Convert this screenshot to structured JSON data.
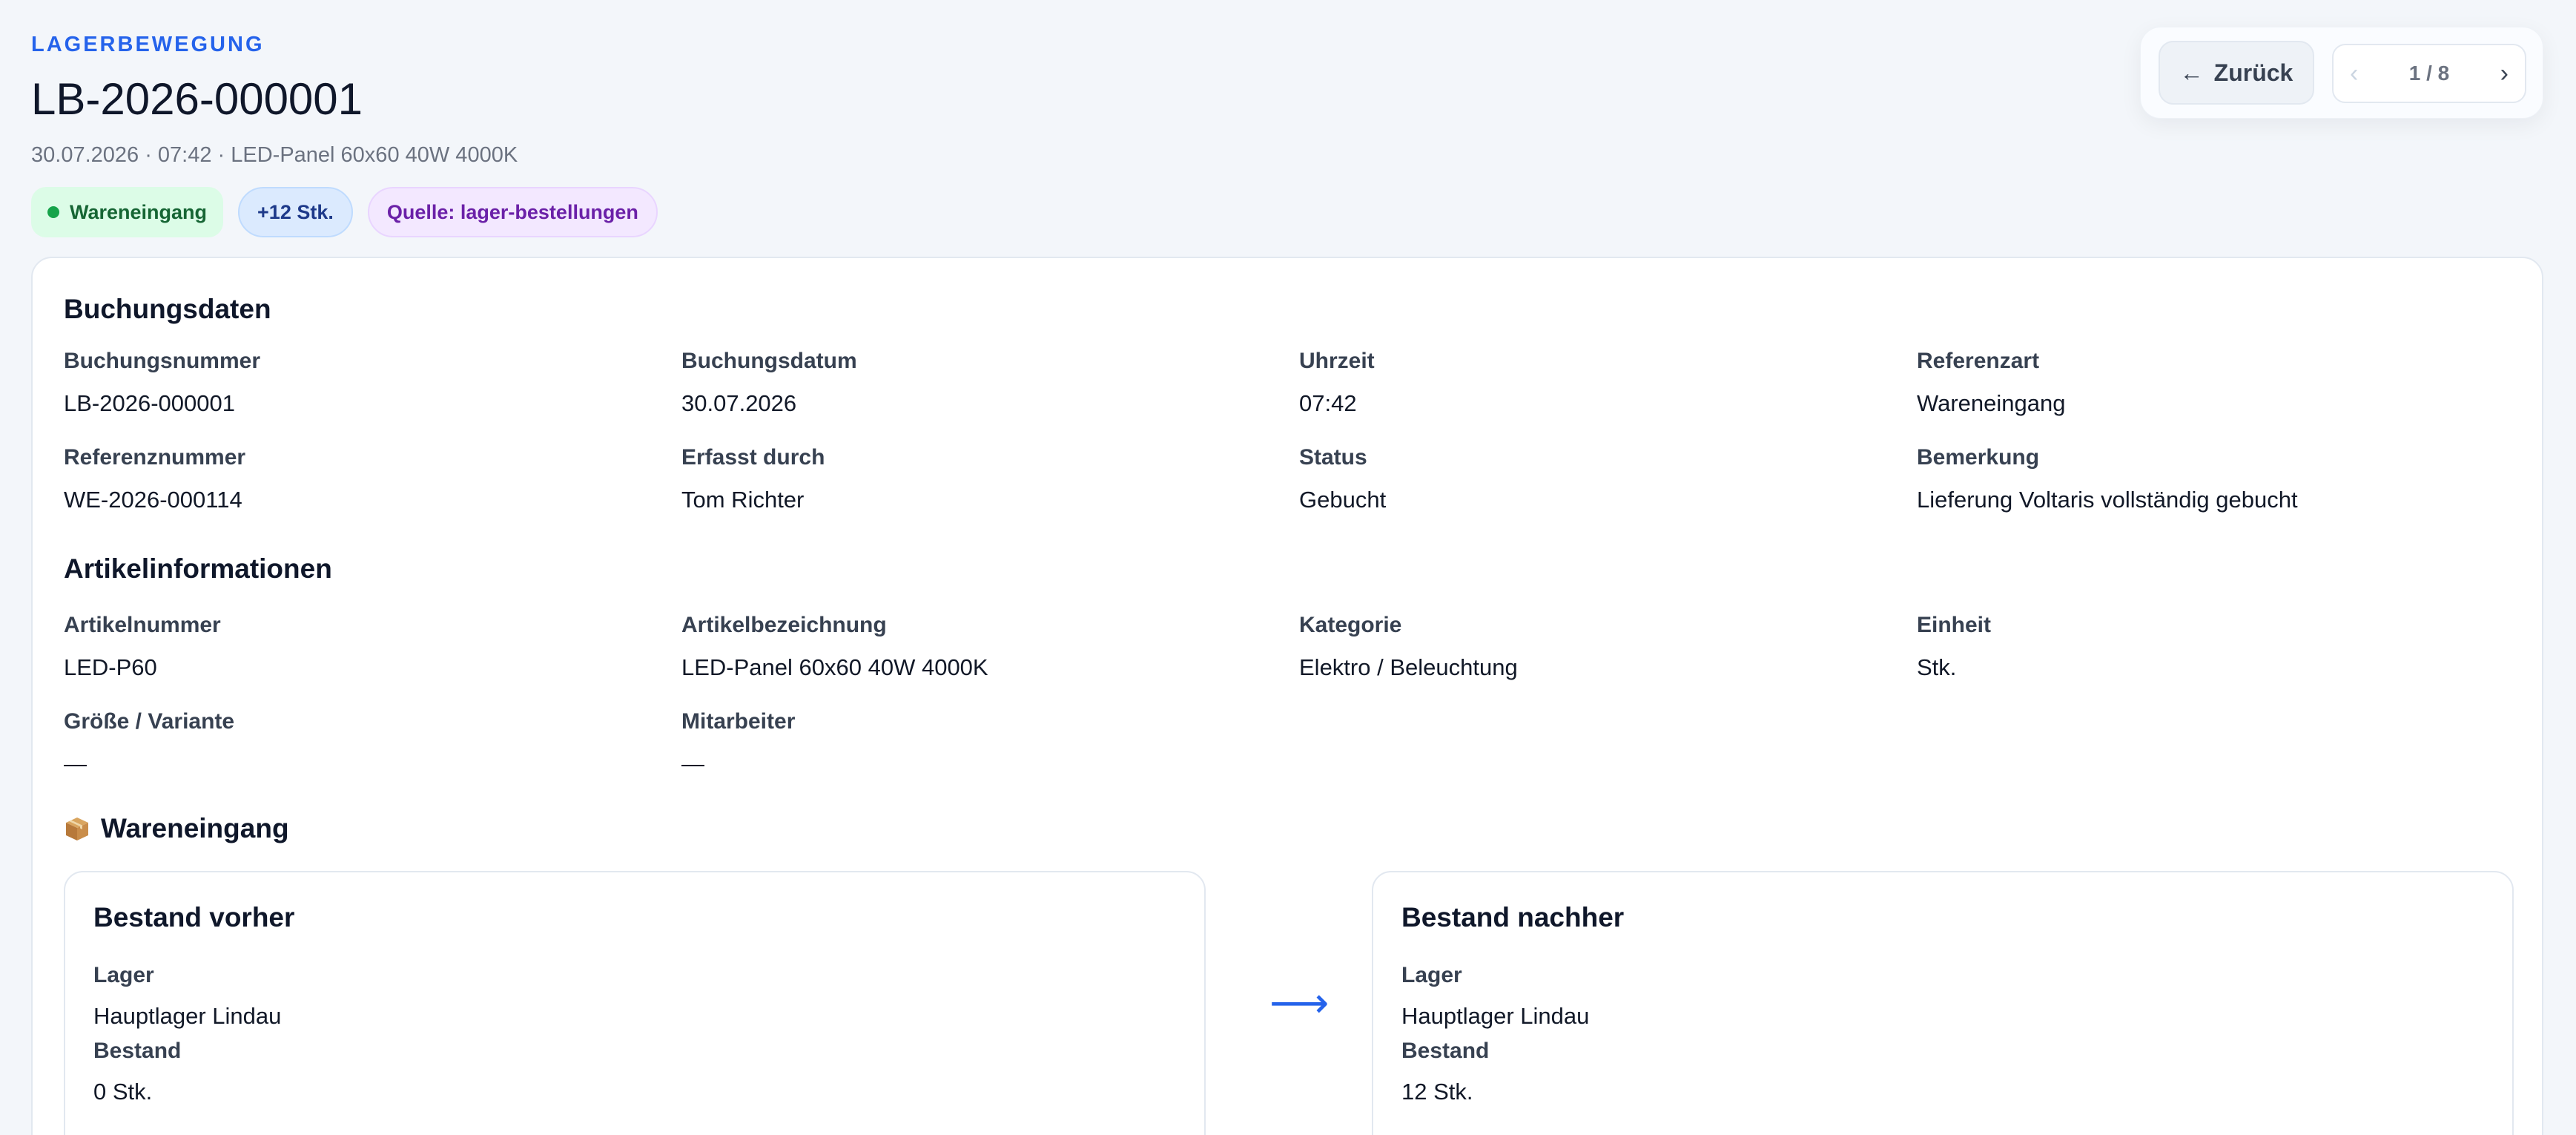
{
  "header": {
    "eyebrow": "LAGERBEWEGUNG",
    "title": "LB-2026-000001",
    "subline": "30.07.2026 · 07:42 · LED-Panel 60x60 40W 4000K",
    "badges": {
      "type": "Wareneingang",
      "quantity": "+12 Stk.",
      "source": "Quelle: lager-bestellungen"
    }
  },
  "nav": {
    "back_arrow": "←",
    "back_label": "Zurück",
    "prev": "‹",
    "page_indicator": "1 / 8",
    "next": "›"
  },
  "booking": {
    "title": "Buchungsdaten",
    "fields": [
      {
        "label": "Buchungsnummer",
        "value": "LB-2026-000001"
      },
      {
        "label": "Buchungsdatum",
        "value": "30.07.2026"
      },
      {
        "label": "Uhrzeit",
        "value": "07:42"
      },
      {
        "label": "Referenzart",
        "value": "Wareneingang"
      },
      {
        "label": "Referenznummer",
        "value": "WE-2026-000114"
      },
      {
        "label": "Erfasst durch",
        "value": "Tom Richter"
      },
      {
        "label": "Status",
        "value": "Gebucht"
      },
      {
        "label": "Bemerkung",
        "value": "Lieferung Voltaris vollständig gebucht"
      }
    ]
  },
  "article": {
    "title": "Artikelinformationen",
    "fields": [
      {
        "label": "Artikelnummer",
        "value": "LED-P60"
      },
      {
        "label": "Artikelbezeichnung",
        "value": "LED-Panel 60x60 40W 4000K"
      },
      {
        "label": "Kategorie",
        "value": "Elektro / Beleuchtung"
      },
      {
        "label": "Einheit",
        "value": "Stk."
      },
      {
        "label": "Größe / Variante",
        "value": "—"
      },
      {
        "label": "Mitarbeiter",
        "value": "—"
      }
    ]
  },
  "movement": {
    "icon": "package-icon",
    "title": "Wareneingang",
    "arrow": "⟶",
    "before": {
      "title": "Bestand vorher",
      "warehouse_label": "Lager",
      "warehouse_value": "Hauptlager Lindau",
      "stock_label": "Bestand",
      "stock_value": "0 Stk."
    },
    "after": {
      "title": "Bestand nachher",
      "warehouse_label": "Lager",
      "warehouse_value": "Hauptlager Lindau",
      "stock_label": "Bestand",
      "stock_value": "12 Stk."
    }
  },
  "colors": {
    "accent": "#2563eb",
    "background": "#f3f6fa",
    "badge_green": "#dcfce7",
    "badge_blue": "#dbeafe",
    "badge_purple": "#f3e8ff"
  }
}
